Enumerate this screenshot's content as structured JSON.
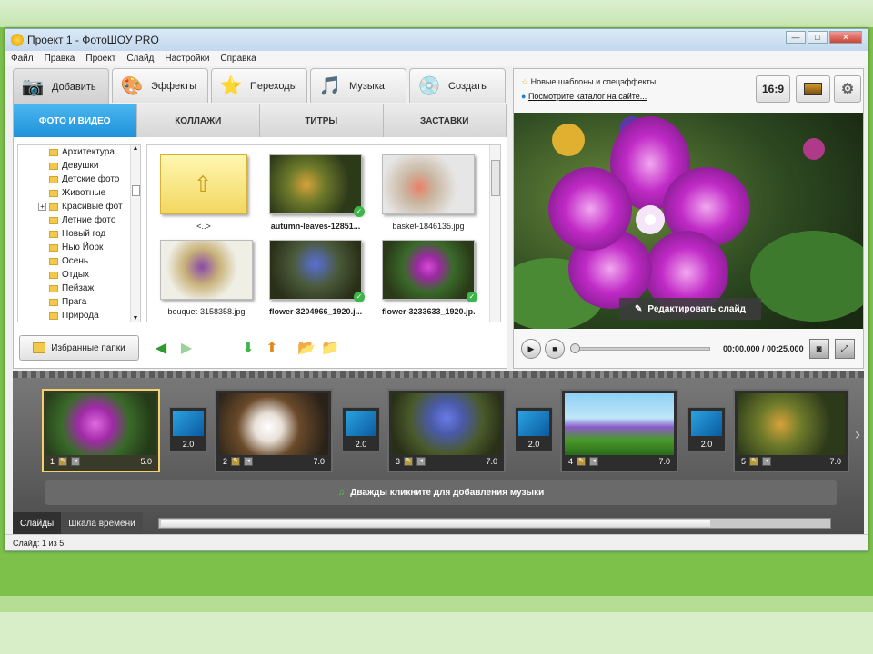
{
  "window": {
    "title": "Проект 1 - ФотоШОУ PRO",
    "minimize": "—",
    "maximize": "□",
    "close": "✕"
  },
  "menu": [
    "Файл",
    "Правка",
    "Проект",
    "Слайд",
    "Настройки",
    "Справка"
  ],
  "main_tabs": [
    {
      "label": "Добавить",
      "icon": "camera-icon",
      "glyph": "📷"
    },
    {
      "label": "Эффекты",
      "icon": "palette-icon",
      "glyph": "🎨"
    },
    {
      "label": "Переходы",
      "icon": "star-icon",
      "glyph": "⭐"
    },
    {
      "label": "Музыка",
      "icon": "music-icon",
      "glyph": "🎵"
    },
    {
      "label": "Создать",
      "icon": "disc-icon",
      "glyph": "💿"
    }
  ],
  "sub_tabs": [
    "ФОТО И ВИДЕО",
    "КОЛЛАЖИ",
    "ТИТРЫ",
    "ЗАСТАВКИ"
  ],
  "folders": [
    "Архитектура",
    "Девушки",
    "Детские фото",
    "Животные",
    "Красивые фот",
    "Летние фото",
    "Новый год",
    "Нью Йорк",
    "Осень",
    "Отдых",
    "Пейзаж",
    "Прага",
    "Природа"
  ],
  "tree_scroll": {
    "up": "▲",
    "down": "▼"
  },
  "files": [
    {
      "name": "<..>",
      "bold": false,
      "used": false
    },
    {
      "name": "autumn-leaves-12851...",
      "bold": true,
      "used": true
    },
    {
      "name": "basket-1846135.jpg",
      "bold": false,
      "used": false
    },
    {
      "name": "bouquet-3158358.jpg",
      "bold": false,
      "used": false
    },
    {
      "name": "flower-3204966_1920.j...",
      "bold": true,
      "used": true
    },
    {
      "name": "flower-3233633_1920.jp...",
      "bold": true,
      "used": true
    }
  ],
  "check_glyph": "✓",
  "favorites_button": "Избранные папки",
  "news": {
    "line1": "Новые шаблоны и спецэффекты",
    "line2": "Посмотрите каталог на сайте..."
  },
  "aspect_button": "16:9",
  "edit_slide_button": "Редактировать слайд",
  "player": {
    "play": "▶",
    "stop": "■",
    "time": "00:00.000 / 00:25.000",
    "progress": 0
  },
  "slides": [
    {
      "num": "1",
      "duration": "5.0",
      "selected": true
    },
    {
      "num": "2",
      "duration": "7.0",
      "selected": false
    },
    {
      "num": "3",
      "duration": "7.0",
      "selected": false
    },
    {
      "num": "4",
      "duration": "7.0",
      "selected": false
    },
    {
      "num": "5",
      "duration": "7.0",
      "selected": false
    }
  ],
  "transitions": [
    "2.0",
    "2.0",
    "2.0",
    "2.0"
  ],
  "music_hint": "Дважды кликните для добавления музыки",
  "bottom_tabs": [
    "Слайды",
    "Шкала времени"
  ],
  "status": "Слайд: 1 из 5",
  "colors": {
    "accent": "#1e92d9",
    "selected_slide": "#f0d36a",
    "check": "#3cb54a"
  }
}
